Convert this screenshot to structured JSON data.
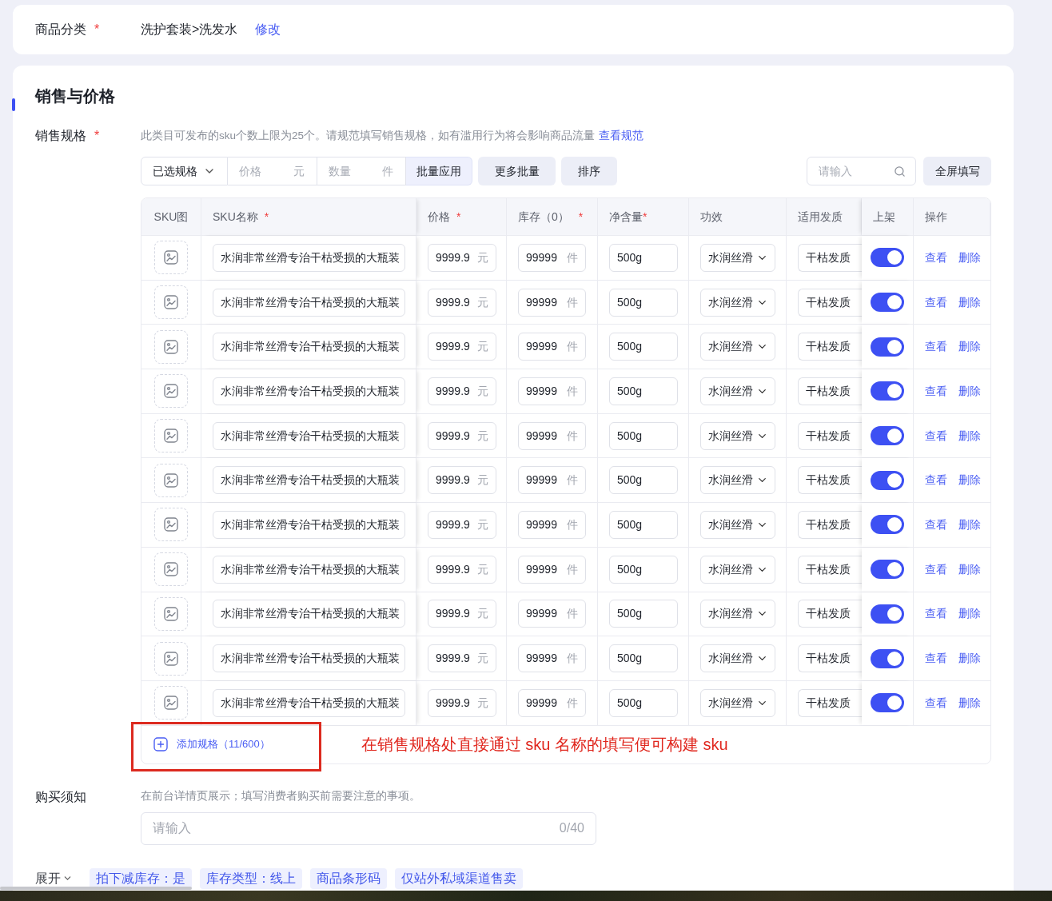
{
  "category": {
    "label": "商品分类",
    "required_mark": "*",
    "value": "洗护套装>洗发水",
    "edit_link": "修改"
  },
  "section": {
    "title": "销售与价格"
  },
  "sales_spec": {
    "label": "销售规格",
    "required_mark": "*",
    "hint": "此类目可发布的sku个数上限为25个。请规范填写销售规格，如有滥用行为将会影响商品流量",
    "hint_link": "查看规范"
  },
  "toolbar": {
    "spec_select": "已选规格",
    "price": {
      "placeholder": "价格",
      "unit": "元"
    },
    "quantity": {
      "placeholder": "数量",
      "unit": "件"
    },
    "apply_button": "批量应用",
    "buttons": [
      "更多批量",
      "排序"
    ],
    "search": {
      "placeholder": "请输入"
    },
    "fullscreen_button": "全屏填写"
  },
  "table": {
    "columns": [
      {
        "label": "SKU图"
      },
      {
        "label": "SKU名称",
        "required_mark": "*"
      },
      {
        "label": "价格",
        "required_mark": "*"
      },
      {
        "label": "库存（0）",
        "required_mark": "*"
      },
      {
        "label": "净含量",
        "required_mark": "*"
      },
      {
        "label": "功效"
      },
      {
        "label": "适用发质"
      },
      {
        "label": "上架"
      },
      {
        "label": "操作"
      }
    ],
    "rows": [
      {
        "name": "水润非常丝滑专治干枯受损的大瓶装",
        "price": "9999.9",
        "price_unit": "元",
        "stock": "99999",
        "stock_unit": "件",
        "net_content": "500g",
        "effect": "水润丝滑",
        "hair_type": "干枯发质",
        "listed": true,
        "actions": [
          "查看",
          "删除"
        ]
      },
      {
        "name": "水润非常丝滑专治干枯受损的大瓶装",
        "price": "9999.9",
        "price_unit": "元",
        "stock": "99999",
        "stock_unit": "件",
        "net_content": "500g",
        "effect": "水润丝滑",
        "hair_type": "干枯发质",
        "listed": true,
        "actions": [
          "查看",
          "删除"
        ]
      },
      {
        "name": "水润非常丝滑专治干枯受损的大瓶装",
        "price": "9999.9",
        "price_unit": "元",
        "stock": "99999",
        "stock_unit": "件",
        "net_content": "500g",
        "effect": "水润丝滑",
        "hair_type": "干枯发质",
        "listed": true,
        "actions": [
          "查看",
          "删除"
        ]
      },
      {
        "name": "水润非常丝滑专治干枯受损的大瓶装",
        "price": "9999.9",
        "price_unit": "元",
        "stock": "99999",
        "stock_unit": "件",
        "net_content": "500g",
        "effect": "水润丝滑",
        "hair_type": "干枯发质",
        "listed": true,
        "actions": [
          "查看",
          "删除"
        ]
      },
      {
        "name": "水润非常丝滑专治干枯受损的大瓶装",
        "price": "9999.9",
        "price_unit": "元",
        "stock": "99999",
        "stock_unit": "件",
        "net_content": "500g",
        "effect": "水润丝滑",
        "hair_type": "干枯发质",
        "listed": true,
        "actions": [
          "查看",
          "删除"
        ]
      },
      {
        "name": "水润非常丝滑专治干枯受损的大瓶装",
        "price": "9999.9",
        "price_unit": "元",
        "stock": "99999",
        "stock_unit": "件",
        "net_content": "500g",
        "effect": "水润丝滑",
        "hair_type": "干枯发质",
        "listed": true,
        "actions": [
          "查看",
          "删除"
        ]
      },
      {
        "name": "水润非常丝滑专治干枯受损的大瓶装",
        "price": "9999.9",
        "price_unit": "元",
        "stock": "99999",
        "stock_unit": "件",
        "net_content": "500g",
        "effect": "水润丝滑",
        "hair_type": "干枯发质",
        "listed": true,
        "actions": [
          "查看",
          "删除"
        ]
      },
      {
        "name": "水润非常丝滑专治干枯受损的大瓶装",
        "price": "9999.9",
        "price_unit": "元",
        "stock": "99999",
        "stock_unit": "件",
        "net_content": "500g",
        "effect": "水润丝滑",
        "hair_type": "干枯发质",
        "listed": true,
        "actions": [
          "查看",
          "删除"
        ]
      },
      {
        "name": "水润非常丝滑专治干枯受损的大瓶装",
        "price": "9999.9",
        "price_unit": "元",
        "stock": "99999",
        "stock_unit": "件",
        "net_content": "500g",
        "effect": "水润丝滑",
        "hair_type": "干枯发质",
        "listed": true,
        "actions": [
          "查看",
          "删除"
        ]
      },
      {
        "name": "水润非常丝滑专治干枯受损的大瓶装",
        "price": "9999.9",
        "price_unit": "元",
        "stock": "99999",
        "stock_unit": "件",
        "net_content": "500g",
        "effect": "水润丝滑",
        "hair_type": "干枯发质",
        "listed": true,
        "actions": [
          "查看",
          "删除"
        ]
      },
      {
        "name": "水润非常丝滑专治干枯受损的大瓶装",
        "price": "9999.9",
        "price_unit": "元",
        "stock": "99999",
        "stock_unit": "件",
        "net_content": "500g",
        "effect": "水润丝滑",
        "hair_type": "干枯发质",
        "listed": true,
        "actions": [
          "查看",
          "删除"
        ]
      }
    ],
    "add_button": "添加规格（11/600）"
  },
  "annotation": "在销售规格处直接通过 sku 名称的填写便可构建 sku",
  "purchase_notes": {
    "label": "购买须知",
    "hint": "在前台详情页展示；填写消费者购买前需要注意的事项。",
    "placeholder": "请输入",
    "counter": "0/40"
  },
  "footer": {
    "expand": "展开",
    "tags": [
      "拍下减库存：是",
      "库存类型：线上",
      "商品条形码",
      "仅站外私域渠道售卖"
    ]
  }
}
